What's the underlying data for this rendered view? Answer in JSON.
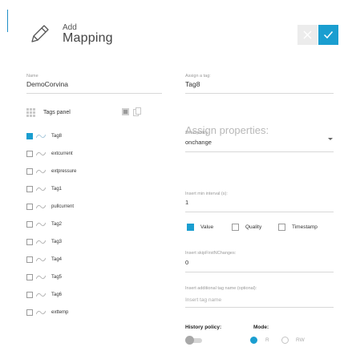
{
  "header": {
    "small_title": "Add",
    "title": "Mapping",
    "cancel_icon": "close-icon",
    "confirm_icon": "check-icon",
    "accent": "#1a9ed0"
  },
  "name_field": {
    "label": "Name",
    "value": "DemoCorvina"
  },
  "assign_tag": {
    "label": "Assign a tag:",
    "value": "Tag8"
  },
  "tags_panel": {
    "title": "Tags panel",
    "tags": [
      {
        "name": "Tag8",
        "checked": true
      },
      {
        "name": "extcurrent",
        "checked": false
      },
      {
        "name": "extpressure",
        "checked": false
      },
      {
        "name": "Tag1",
        "checked": false
      },
      {
        "name": "pullcurrent",
        "checked": false
      },
      {
        "name": "Tag2",
        "checked": false
      },
      {
        "name": "Tag3",
        "checked": false
      },
      {
        "name": "Tag4",
        "checked": false
      },
      {
        "name": "Tag5",
        "checked": false
      },
      {
        "name": "Tag6",
        "checked": false
      },
      {
        "name": "exttemp",
        "checked": false
      }
    ]
  },
  "properties": {
    "heading": "Assign properties:",
    "send_policy": {
      "label": "Send policy",
      "value": "onchange"
    },
    "min_interval": {
      "label": "Insert min interval (s):",
      "value": "1"
    },
    "options": [
      {
        "label": "Value",
        "checked": true
      },
      {
        "label": "Quality",
        "checked": false
      },
      {
        "label": "Timestamp",
        "checked": false
      }
    ],
    "skip_changes": {
      "label": "Insert skipFirstNChanges:",
      "value": "0"
    },
    "additional_name": {
      "label": "Insert additional tag name (optional):",
      "placeholder": "Insert tag name"
    },
    "history_policy": {
      "label": "History policy:",
      "enabled": false
    },
    "mode": {
      "label": "Mode:",
      "options": [
        "R",
        "RW"
      ],
      "selected": "R"
    }
  }
}
